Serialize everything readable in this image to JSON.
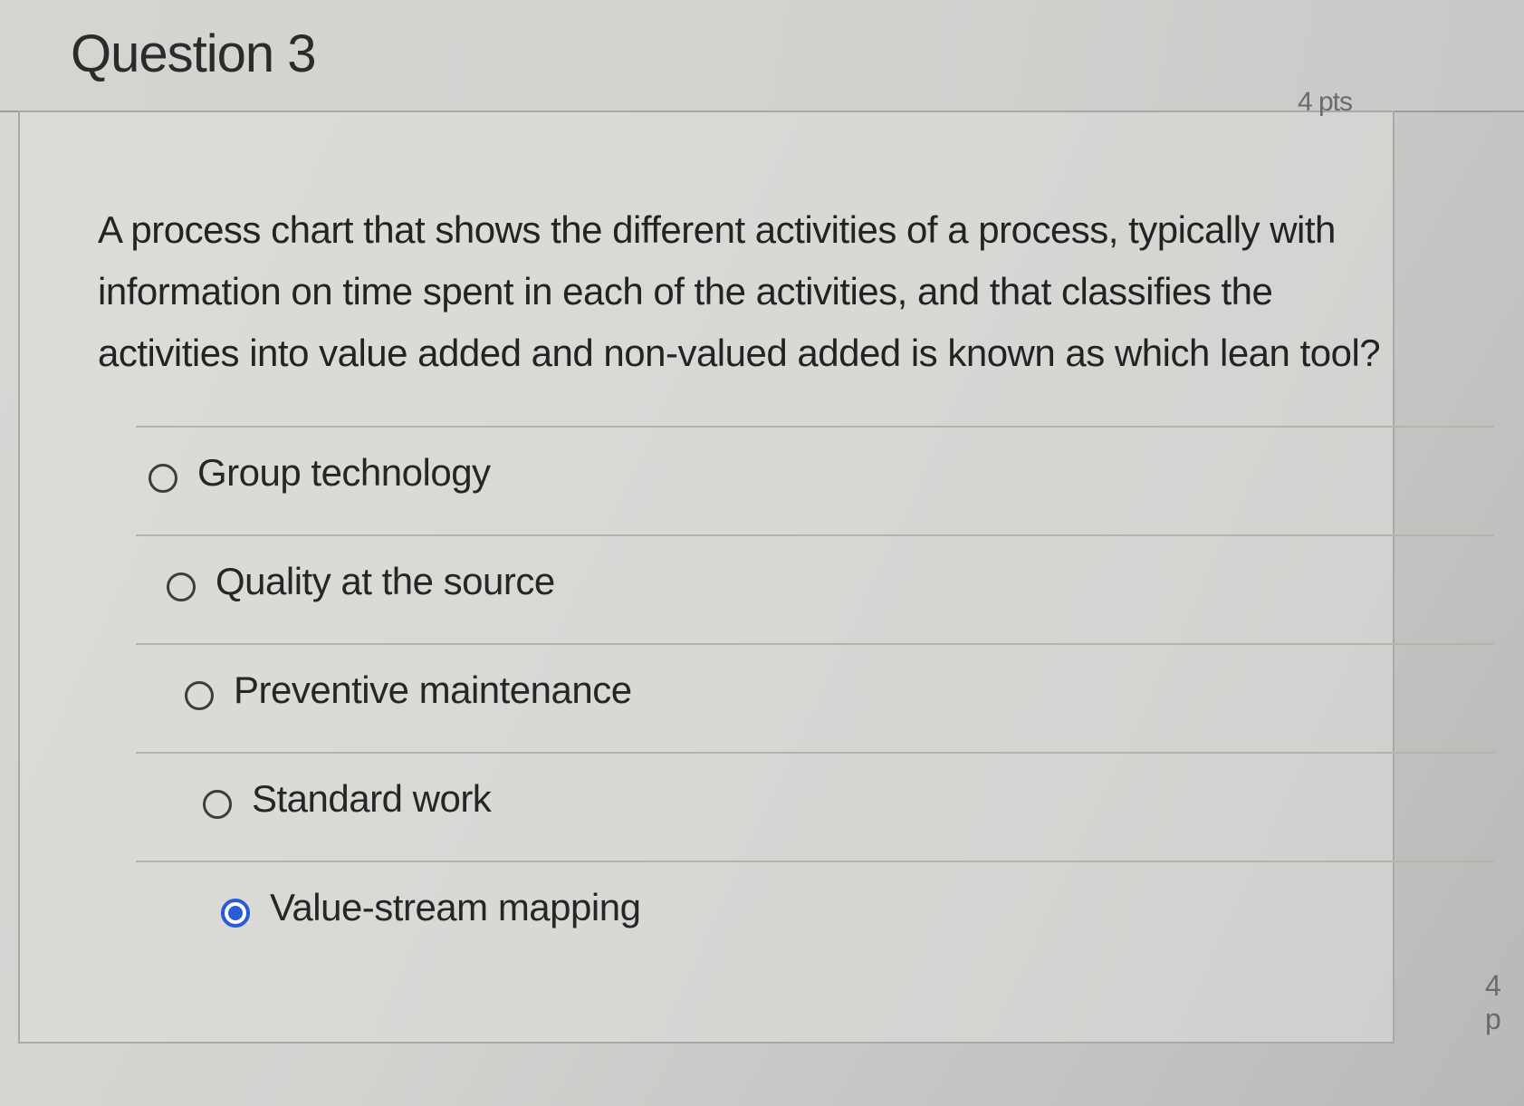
{
  "question": {
    "title": "Question 3",
    "points": "4 pts",
    "text": "A process chart that shows the different activities of a process, typically with information on time spent in each of the activities, and that classifies the activities into value added and non-valued added is known as which lean tool?",
    "answers": [
      {
        "label": "Group technology",
        "selected": false
      },
      {
        "label": "Quality at the source",
        "selected": false
      },
      {
        "label": "Preventive maintenance",
        "selected": false
      },
      {
        "label": "Standard work",
        "selected": false
      },
      {
        "label": "Value-stream mapping",
        "selected": true
      }
    ]
  },
  "next_question": {
    "points_partial": "4 p"
  },
  "colors": {
    "selected_radio": "#2a5bd7"
  }
}
